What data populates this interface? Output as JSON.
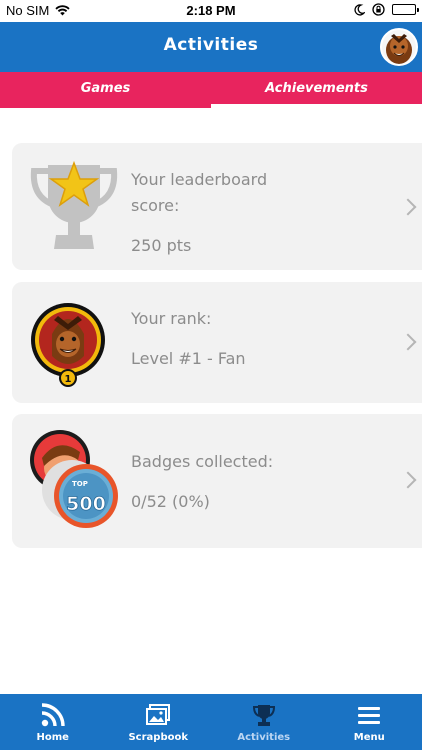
{
  "status_bar": {
    "carrier": "No SIM",
    "time": "2:18 PM"
  },
  "header": {
    "title": "Activities"
  },
  "tabs": [
    {
      "label": "Games",
      "active": false
    },
    {
      "label": "Achievements",
      "active": true
    }
  ],
  "cards": {
    "leaderboard": {
      "label_line1": "Your leaderboard",
      "label_line2": "score:",
      "value": "250 pts",
      "icon": "trophy-icon"
    },
    "rank": {
      "label": "Your rank:",
      "value": "Level #1 - Fan",
      "icon": "rank-medal-icon",
      "medal_number": "1"
    },
    "badges": {
      "label": "Badges collected:",
      "value": "0/52 (0%)",
      "icon": "badge-icon",
      "badge_top": "TOP",
      "badge_number": "500"
    }
  },
  "bottom_nav": [
    {
      "label": "Home",
      "icon": "rss-icon"
    },
    {
      "label": "Scrapbook",
      "icon": "photos-icon"
    },
    {
      "label": "Activities",
      "icon": "trophy-icon",
      "active": true
    },
    {
      "label": "Menu",
      "icon": "menu-icon"
    }
  ],
  "colors": {
    "primary_blue": "#1a73c4",
    "tab_pink": "#e8245e",
    "card_bg": "#f2f2f2",
    "text_gray": "#8c8c8c",
    "gold": "#f2b90c"
  }
}
